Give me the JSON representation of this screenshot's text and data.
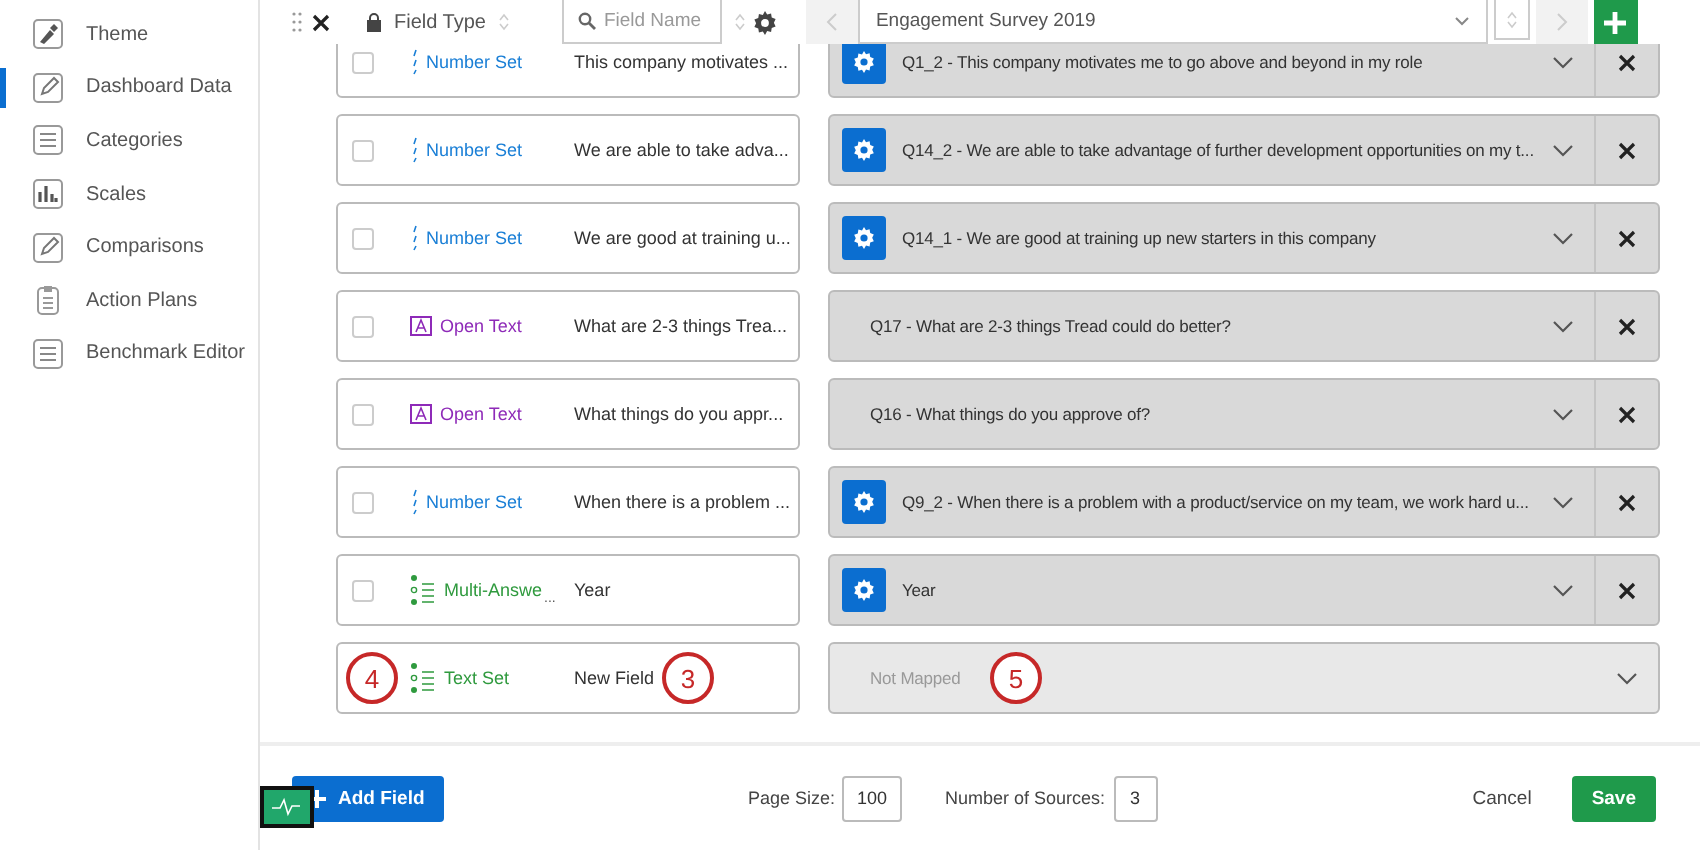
{
  "sidebar": {
    "items": [
      {
        "label": "Theme",
        "selected": false
      },
      {
        "label": "Dashboard Data",
        "selected": true
      },
      {
        "label": "Categories",
        "selected": false
      },
      {
        "label": "Scales",
        "selected": false
      },
      {
        "label": "Comparisons",
        "selected": false
      },
      {
        "label": "Action Plans",
        "selected": false
      },
      {
        "label": "Benchmark Editor",
        "selected": false
      }
    ]
  },
  "header": {
    "field_type": "Field Type",
    "search": {
      "placeholder": "Field Name"
    },
    "source": {
      "value": "Engagement Survey 2019"
    },
    "prev_disabled": true,
    "next_disabled": true
  },
  "rows": [
    {
      "kind": "number",
      "checked": false,
      "type_label": "Number Set",
      "name": "This company motivates ...",
      "mapping": {
        "mapped": true,
        "gear": true,
        "text": "Q1_2 - This company motivates me to go above and beyond in my role",
        "removable": true
      }
    },
    {
      "kind": "number",
      "checked": false,
      "type_label": "Number Set",
      "name": "We are able to take adva...",
      "mapping": {
        "mapped": true,
        "gear": true,
        "text": "Q14_2 - We are able to take advantage of further development opportunities on my t...",
        "removable": true
      }
    },
    {
      "kind": "number",
      "checked": false,
      "type_label": "Number Set",
      "name": "We are good at training u...",
      "mapping": {
        "mapped": true,
        "gear": true,
        "text": "Q14_1 - We are good at training up new starters in this company",
        "removable": true
      }
    },
    {
      "kind": "open-text",
      "checked": false,
      "type_label": "Open Text",
      "name": "What are 2-3 things Trea...",
      "mapping": {
        "mapped": true,
        "gear": false,
        "text": "Q17 - What are 2-3 things Tread could do better?",
        "removable": true
      }
    },
    {
      "kind": "open-text",
      "checked": false,
      "type_label": "Open Text",
      "name": "What things do you appr...",
      "mapping": {
        "mapped": true,
        "gear": false,
        "text": "Q16 - What things do you approve of?",
        "removable": true
      }
    },
    {
      "kind": "number",
      "checked": false,
      "type_label": "Number Set",
      "name": "When there is a problem ...",
      "mapping": {
        "mapped": true,
        "gear": true,
        "text": "Q9_2 - When there is a problem with a product/service on my team, we work hard u...",
        "removable": true
      }
    },
    {
      "kind": "multi-answer",
      "checked": false,
      "type_label": "Multi-Answe",
      "type_more": "...",
      "name": "Year",
      "mapping": {
        "mapped": true,
        "gear": true,
        "text": "Year",
        "removable": true
      }
    },
    {
      "kind": "text-set",
      "type_label": "Text Set",
      "name": "New Field",
      "callouts": [
        "4",
        "3"
      ],
      "mapping": {
        "mapped": false,
        "gear": false,
        "text": "Not Mapped",
        "removable": false,
        "callout": "5"
      }
    }
  ],
  "footer": {
    "add_field": "Add Field",
    "page_size_label": "Page Size:",
    "page_size": "100",
    "sources_label": "Number of Sources:",
    "sources": "3",
    "cancel": "Cancel",
    "save": "Save"
  }
}
